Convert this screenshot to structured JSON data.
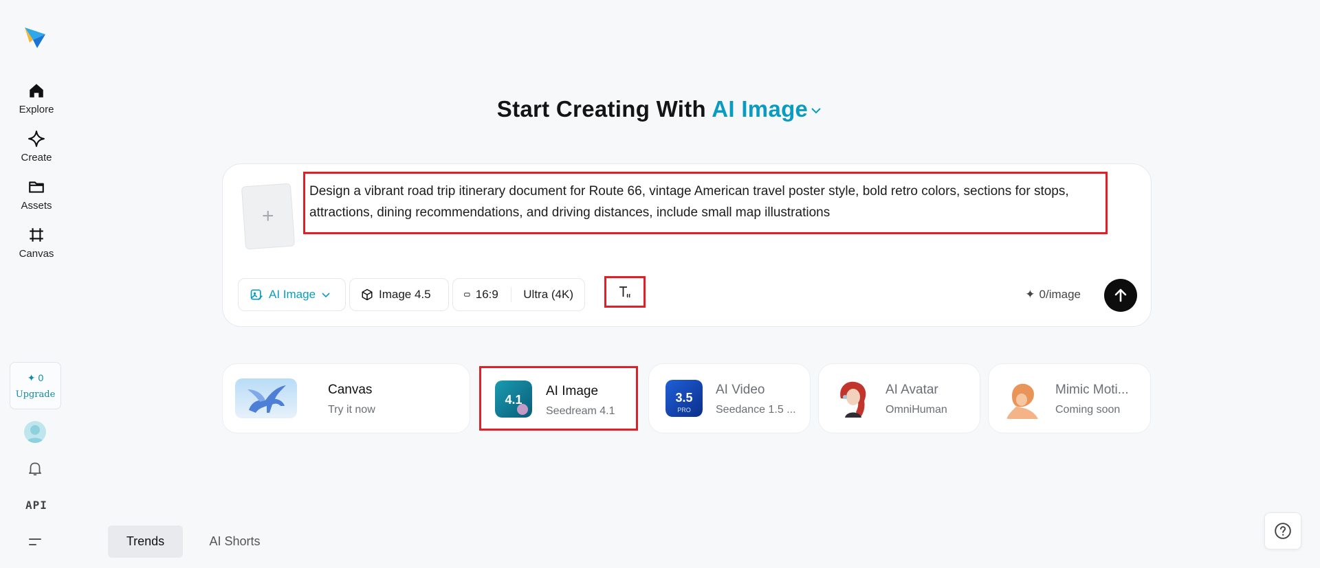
{
  "sidebar": {
    "items": [
      {
        "label": "Explore",
        "icon": "home-icon"
      },
      {
        "label": "Create",
        "icon": "diamond-sparkle-icon"
      },
      {
        "label": "Assets",
        "icon": "folder-icon"
      },
      {
        "label": "Canvas",
        "icon": "frame-icon"
      }
    ],
    "credits": "0",
    "upgrade_label": "Upgrade",
    "api_label": "API"
  },
  "heading": {
    "prefix": "Start Creating With",
    "mode": "AI Image"
  },
  "prompt": {
    "text": "Design a vibrant road trip itinerary document for Route 66, vintage American travel poster style, bold retro colors, sections for stops, attractions, dining recommendations, and driving distances, include small map illustrations",
    "upload_symbol": "+"
  },
  "toolbar": {
    "mode_label": "AI Image",
    "model_label": "Image 4.5",
    "ratio_label": "16:9",
    "quality_label": "Ultra (4K)",
    "cost_label": "0/image"
  },
  "cards": [
    {
      "title": "Canvas",
      "sub": "Try it now"
    },
    {
      "title": "AI Image",
      "sub": "Seedream 4.1",
      "badge": "4.1"
    },
    {
      "title": "AI Video",
      "sub": "Seedance 1.5 ...",
      "badge": "3.5",
      "badge_sub": "PRO"
    },
    {
      "title": "AI Avatar",
      "sub": "OmniHuman"
    },
    {
      "title": "Mimic Moti...",
      "sub": "Coming soon"
    }
  ],
  "tabs": [
    {
      "label": "Trends"
    },
    {
      "label": "AI Shorts"
    }
  ],
  "colors": {
    "accent": "#0a9cc0",
    "highlight": "#e21f26",
    "background": "#f7f8fa"
  }
}
